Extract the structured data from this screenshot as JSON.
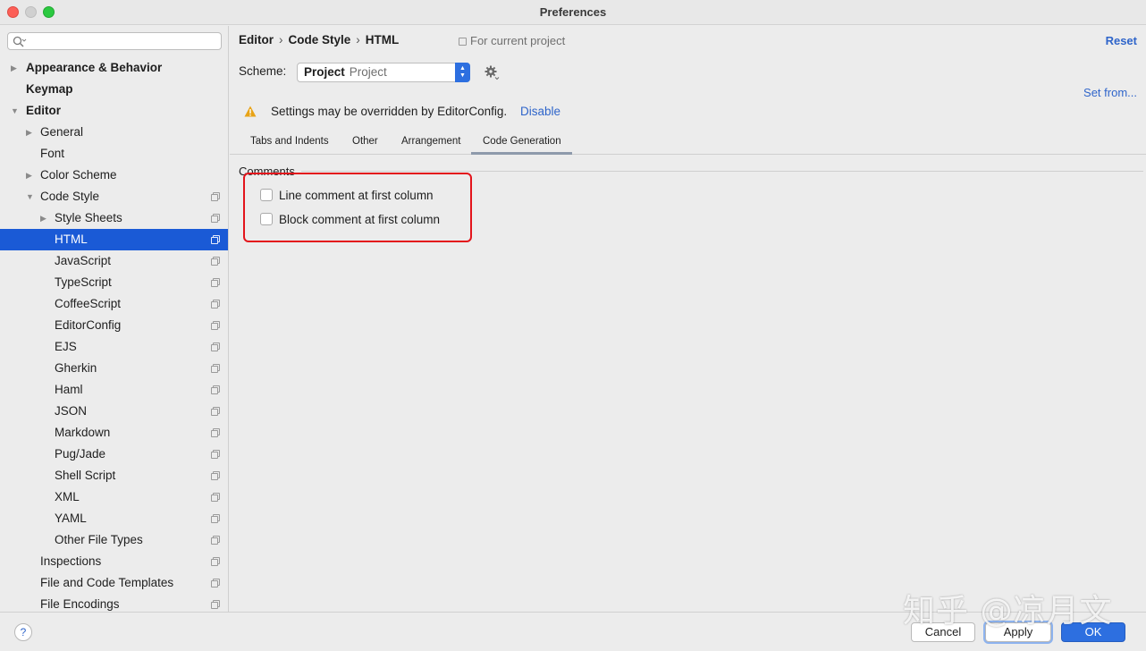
{
  "window": {
    "title": "Preferences"
  },
  "sidebar": {
    "search": {
      "placeholder": "",
      "value": ""
    },
    "items": [
      {
        "label": "Appearance & Behavior",
        "level": 0,
        "arrow": "▶",
        "bold": true,
        "copy": false,
        "selected": false
      },
      {
        "label": "Keymap",
        "level": 0,
        "arrow": "",
        "bold": true,
        "copy": false,
        "selected": false
      },
      {
        "label": "Editor",
        "level": 0,
        "arrow": "▼",
        "bold": true,
        "copy": false,
        "selected": false
      },
      {
        "label": "General",
        "level": 1,
        "arrow": "▶",
        "bold": false,
        "copy": false,
        "selected": false
      },
      {
        "label": "Font",
        "level": 1,
        "arrow": "",
        "bold": false,
        "copy": false,
        "selected": false
      },
      {
        "label": "Color Scheme",
        "level": 1,
        "arrow": "▶",
        "bold": false,
        "copy": false,
        "selected": false
      },
      {
        "label": "Code Style",
        "level": 1,
        "arrow": "▼",
        "bold": false,
        "copy": true,
        "selected": false
      },
      {
        "label": "Style Sheets",
        "level": 2,
        "arrow": "▶",
        "bold": false,
        "copy": true,
        "selected": false
      },
      {
        "label": "HTML",
        "level": 2,
        "arrow": "",
        "bold": false,
        "copy": true,
        "selected": true
      },
      {
        "label": "JavaScript",
        "level": 2,
        "arrow": "",
        "bold": false,
        "copy": true,
        "selected": false
      },
      {
        "label": "TypeScript",
        "level": 2,
        "arrow": "",
        "bold": false,
        "copy": true,
        "selected": false
      },
      {
        "label": "CoffeeScript",
        "level": 2,
        "arrow": "",
        "bold": false,
        "copy": true,
        "selected": false
      },
      {
        "label": "EditorConfig",
        "level": 2,
        "arrow": "",
        "bold": false,
        "copy": true,
        "selected": false
      },
      {
        "label": "EJS",
        "level": 2,
        "arrow": "",
        "bold": false,
        "copy": true,
        "selected": false
      },
      {
        "label": "Gherkin",
        "level": 2,
        "arrow": "",
        "bold": false,
        "copy": true,
        "selected": false
      },
      {
        "label": "Haml",
        "level": 2,
        "arrow": "",
        "bold": false,
        "copy": true,
        "selected": false
      },
      {
        "label": "JSON",
        "level": 2,
        "arrow": "",
        "bold": false,
        "copy": true,
        "selected": false
      },
      {
        "label": "Markdown",
        "level": 2,
        "arrow": "",
        "bold": false,
        "copy": true,
        "selected": false
      },
      {
        "label": "Pug/Jade",
        "level": 2,
        "arrow": "",
        "bold": false,
        "copy": true,
        "selected": false
      },
      {
        "label": "Shell Script",
        "level": 2,
        "arrow": "",
        "bold": false,
        "copy": true,
        "selected": false
      },
      {
        "label": "XML",
        "level": 2,
        "arrow": "",
        "bold": false,
        "copy": true,
        "selected": false
      },
      {
        "label": "YAML",
        "level": 2,
        "arrow": "",
        "bold": false,
        "copy": true,
        "selected": false
      },
      {
        "label": "Other File Types",
        "level": 2,
        "arrow": "",
        "bold": false,
        "copy": true,
        "selected": false
      },
      {
        "label": "Inspections",
        "level": 1,
        "arrow": "",
        "bold": false,
        "copy": true,
        "selected": false
      },
      {
        "label": "File and Code Templates",
        "level": 1,
        "arrow": "",
        "bold": false,
        "copy": true,
        "selected": false
      },
      {
        "label": "File Encodings",
        "level": 1,
        "arrow": "",
        "bold": false,
        "copy": true,
        "selected": false
      }
    ]
  },
  "header": {
    "breadcrumb": [
      "Editor",
      "Code Style",
      "HTML"
    ],
    "breadcrumb_sep": "›",
    "for_project": "For current project",
    "reset": "Reset"
  },
  "scheme": {
    "label": "Scheme:",
    "name": "Project",
    "type": "Project",
    "set_from": "Set from..."
  },
  "warning": {
    "text": "Settings may be overridden by EditorConfig.",
    "link": "Disable",
    "color": "#e8a317"
  },
  "tabs": [
    {
      "label": "Tabs and Indents",
      "active": false
    },
    {
      "label": "Other",
      "active": false
    },
    {
      "label": "Arrangement",
      "active": false
    },
    {
      "label": "Code Generation",
      "active": true
    }
  ],
  "comments": {
    "title": "Comments",
    "options": [
      {
        "label": "Line comment at first column",
        "checked": false
      },
      {
        "label": "Block comment at first column",
        "checked": false
      }
    ]
  },
  "footer": {
    "help": "?",
    "cancel": "Cancel",
    "apply": "Apply",
    "ok": "OK"
  },
  "watermark": "知乎 @凉月文",
  "colors": {
    "accent": "#2d6fe0",
    "selection": "#1a5ad6",
    "link": "#2f65ca",
    "highlight_box": "#e3141b"
  }
}
